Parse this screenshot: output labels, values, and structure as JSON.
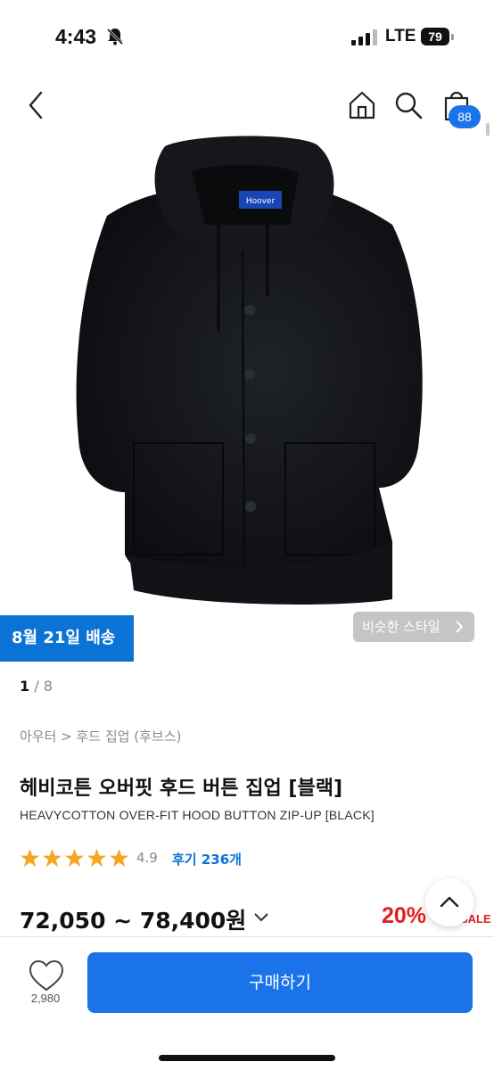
{
  "status_bar": {
    "time": "4:43",
    "network": "LTE",
    "battery": "79"
  },
  "nav": {
    "cart_count": "88"
  },
  "image": {
    "brand_tag": "Hoover",
    "shipping_badge": "8월 21일 배송",
    "similar_style_label": "비슷한 스타일",
    "counter_current": "1",
    "counter_separator": " / ",
    "counter_total": "8"
  },
  "product": {
    "breadcrumb": "아우터 > 후드 집업 (후브스)",
    "title_kr": "헤비코튼 오버핏 후드 버튼 집업 [블랙]",
    "title_en": "HEAVYCOTTON OVER-FIT HOOD BUTTON ZIP-UP [BLACK]",
    "rating": "4.9",
    "rating_stars": 5,
    "reviews": "후기 236개",
    "price": "72,050 ~ 78,400원",
    "discount": "20%",
    "sale_tag": "SALE"
  },
  "bottom_bar": {
    "like_count": "2,980",
    "buy_label": "구매하기"
  },
  "colors": {
    "accent": "#1a73e8",
    "badge_blue": "#0b73d6",
    "discount_red": "#e0201f",
    "star": "#f5a623"
  }
}
